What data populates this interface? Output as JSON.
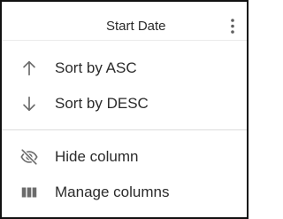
{
  "header": {
    "title": "Start Date",
    "menu_icon": "more-vert-icon"
  },
  "menu": {
    "sort_items": [
      {
        "label": "Sort by ASC",
        "icon": "arrow-up-icon"
      },
      {
        "label": "Sort by DESC",
        "icon": "arrow-down-icon"
      }
    ],
    "column_items": [
      {
        "label": "Hide column",
        "icon": "eye-off-icon"
      },
      {
        "label": "Manage columns",
        "icon": "view-columns-icon"
      }
    ]
  },
  "colors": {
    "border": "#111111",
    "text": "#2b2b2b",
    "icon": "#6b6b6b",
    "divider": "#dddddd"
  }
}
